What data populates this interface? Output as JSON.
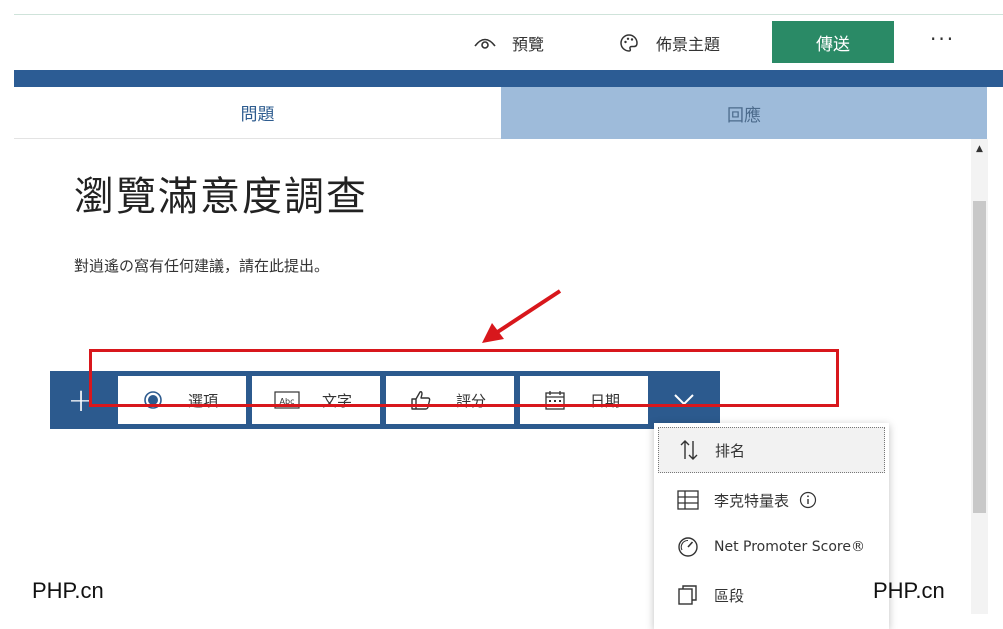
{
  "header": {
    "preview_label": "預覽",
    "theme_label": "佈景主題",
    "send_label": "傳送",
    "more_label": "···"
  },
  "tabs": {
    "questions": "問題",
    "responses": "回應"
  },
  "form": {
    "title": "瀏覽滿意度調查",
    "description": "對逍遙の窩有任何建議，請在此提出。"
  },
  "toolbar": {
    "add_label": "+",
    "choice_label": "選項",
    "text_label": "文字",
    "rating_label": "評分",
    "date_label": "日期"
  },
  "dropdown": {
    "ranking_label": "排名",
    "likert_label": "李克特量表",
    "nps_label": "Net Promoter Score®",
    "section_label": "區段"
  },
  "watermark": {
    "left": "PHP.cn",
    "right": "PHP.cn"
  },
  "colors": {
    "brand_green": "#2a8a66",
    "brand_blue": "#2c5a8e",
    "tab_inactive": "#9ebbda",
    "annotation_red": "#d8171c"
  },
  "icons": {
    "preview": "eye-icon",
    "theme": "palette-icon",
    "choice": "radio-icon",
    "text": "text-box-icon",
    "rating": "thumbs-up-icon",
    "date": "calendar-icon",
    "expand": "chevron-down-icon",
    "ranking": "sort-arrows-icon",
    "likert": "grid-icon",
    "nps": "gauge-icon",
    "section": "section-icon"
  }
}
